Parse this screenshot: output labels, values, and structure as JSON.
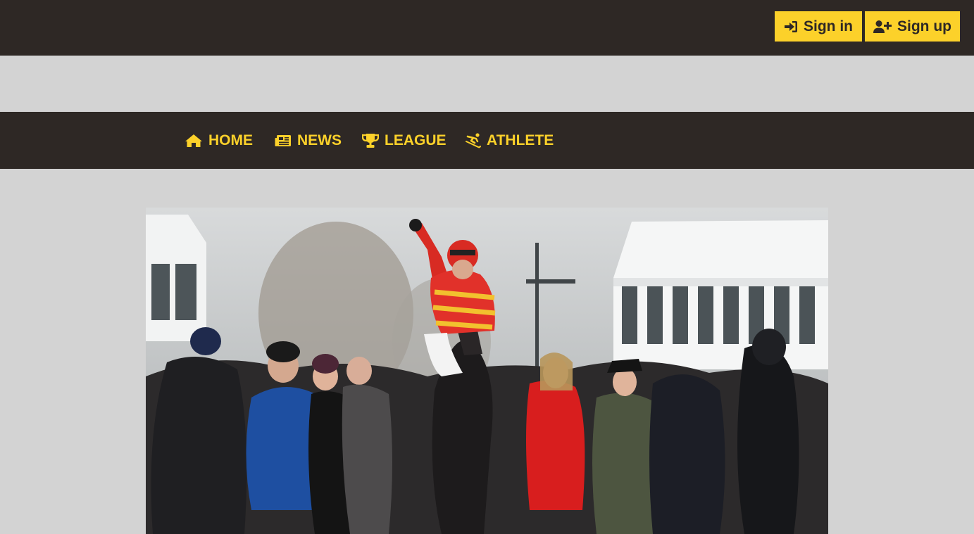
{
  "header": {
    "signin_label": "Sign in",
    "signup_label": "Sign up",
    "signin_icon": "sign-in-icon",
    "signup_icon": "user-plus-icon"
  },
  "nav": {
    "items": [
      {
        "label": "HOME",
        "icon": "home-icon"
      },
      {
        "label": "NEWS",
        "icon": "newspaper-icon"
      },
      {
        "label": "LEAGUE",
        "icon": "trophy-icon"
      },
      {
        "label": "ATHLETE",
        "icon": "skiing-icon"
      }
    ]
  },
  "colors": {
    "dark": "#2e2825",
    "accent": "#fcd12a",
    "page_bg": "#d3d3d3"
  }
}
